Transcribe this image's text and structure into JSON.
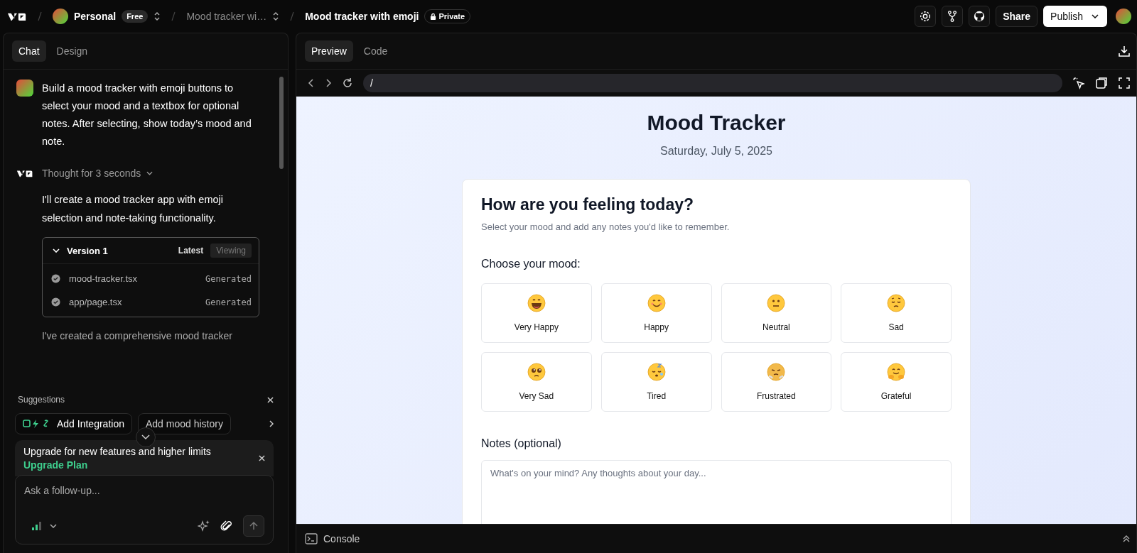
{
  "topbar": {
    "workspace": "Personal",
    "plan_badge": "Free",
    "project": "Mood tracker wi…",
    "chat_title": "Mood tracker with emoji",
    "visibility": "Private",
    "share": "Share",
    "publish": "Publish"
  },
  "left_tabs": [
    {
      "label": "Chat",
      "selected": true
    },
    {
      "label": "Design",
      "selected": false
    }
  ],
  "chat": {
    "user_message": "Build a mood tracker with emoji buttons to select your mood and a textbox for optional notes. After selecting, show today’s mood and note.",
    "thought": "Thought for 3 seconds",
    "reply": "I'll create a mood tracker app with emoji selection and note-taking functionality.",
    "version": {
      "title": "Version 1",
      "latest": "Latest",
      "viewing": "Viewing",
      "expanded": true,
      "files": [
        {
          "name": "mood-tracker.tsx",
          "status": "Generated"
        },
        {
          "name": "app/page.tsx",
          "status": "Generated"
        }
      ]
    },
    "reply_2": "I've created a comprehensive mood tracker"
  },
  "suggestions": {
    "title": "Suggestions",
    "items": [
      "Add Integration",
      "Add mood history"
    ]
  },
  "upgrade": {
    "text": "Upgrade for new features and higher limits",
    "link": "Upgrade Plan"
  },
  "composer": {
    "placeholder": "Ask a follow-up..."
  },
  "right_tabs": [
    {
      "label": "Preview",
      "selected": true
    },
    {
      "label": "Code",
      "selected": false
    }
  ],
  "url": "/",
  "preview": {
    "title": "Mood Tracker",
    "date": "Saturday, July 5, 2025",
    "card_title": "How are you feeling today?",
    "card_subtitle": "Select your mood and add any notes you'd like to remember.",
    "choose_label": "Choose your mood:",
    "moods": [
      {
        "label": "Very Happy",
        "kind": "grin",
        "selected": false
      },
      {
        "label": "Happy",
        "kind": "smile",
        "selected": false
      },
      {
        "label": "Neutral",
        "kind": "neutral",
        "selected": false
      },
      {
        "label": "Sad",
        "kind": "pensive",
        "selected": false
      },
      {
        "label": "Very Sad",
        "kind": "pleading",
        "selected": false
      },
      {
        "label": "Tired",
        "kind": "sleepy",
        "selected": false
      },
      {
        "label": "Frustrated",
        "kind": "steam",
        "selected": false
      },
      {
        "label": "Grateful",
        "kind": "hug",
        "selected": false
      }
    ],
    "notes_label": "Notes (optional)",
    "notes_placeholder": "What's on your mind? Any thoughts about your day..."
  },
  "console": "Console"
}
